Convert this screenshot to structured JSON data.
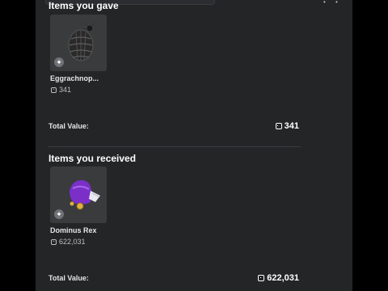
{
  "gave": {
    "title": "Items you gave",
    "items": [
      {
        "name": "Eggrachnop...",
        "price": "341",
        "icon": "egg-spider-icon"
      }
    ],
    "total_label": "Total Value:",
    "total_value": "341"
  },
  "received": {
    "title": "Items you received",
    "items": [
      {
        "name": "Dominus Rex",
        "price": "622,031",
        "icon": "dominus-rex-icon"
      }
    ],
    "total_label": "Total Value:",
    "total_value": "622,031"
  },
  "colors": {
    "panel": "#232527",
    "tile": "#393b3d",
    "text_secondary": "#bdbebe",
    "dominus_purple": "#7b2fc9"
  }
}
